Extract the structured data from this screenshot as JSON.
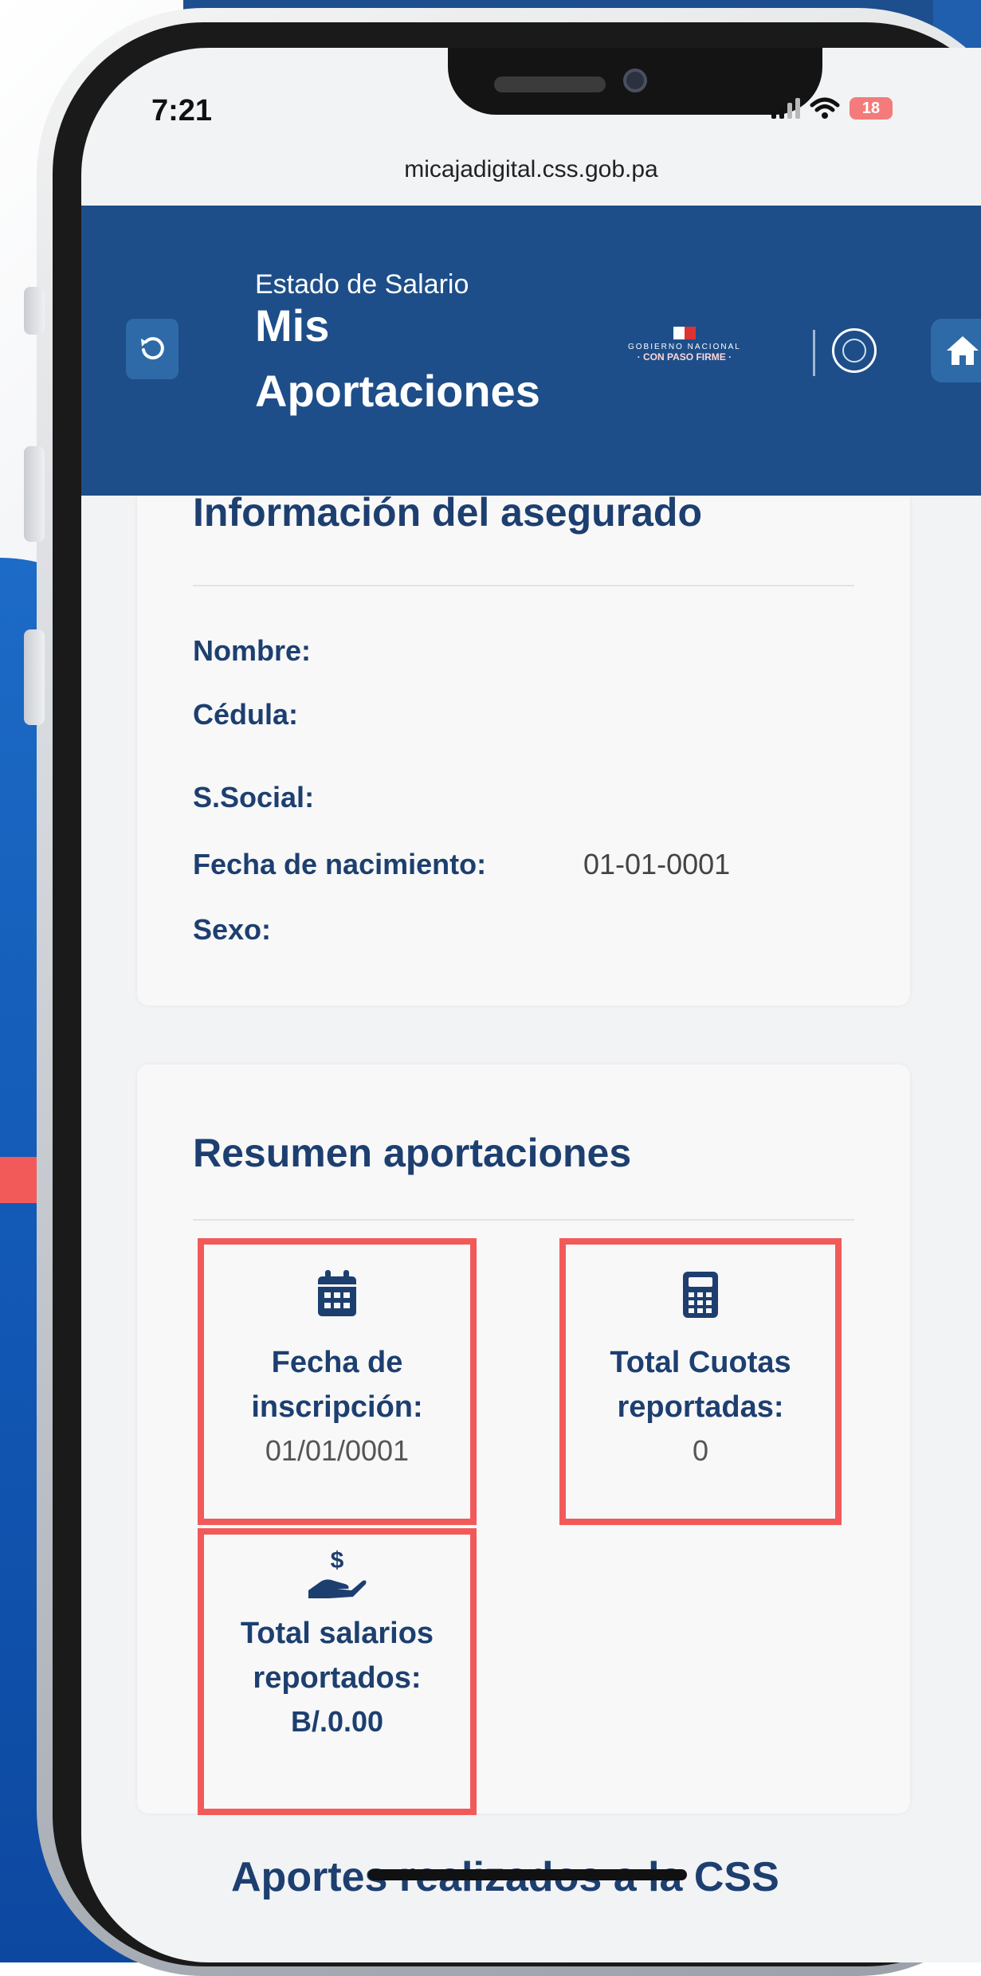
{
  "status_bar": {
    "time": "7:21",
    "battery": "18"
  },
  "browser": {
    "url": "micajadigital.css.gob.pa"
  },
  "header": {
    "subtitle": "Estado de Salario",
    "title_line1": "Mis",
    "title_line2": "Aportaciones",
    "gov_logo_line1": "GOBIERNO NACIONAL",
    "gov_logo_line2": "· CON PASO FIRME ·"
  },
  "insured_info": {
    "title": "Información del asegurado",
    "fields": [
      {
        "label": "Nombre:",
        "value": ""
      },
      {
        "label": "Cédula:",
        "value": ""
      },
      {
        "label": "S.Social:",
        "value": ""
      },
      {
        "label": "Fecha de nacimiento:",
        "value": "01-01-0001"
      },
      {
        "label": "Sexo:",
        "value": ""
      }
    ]
  },
  "summary": {
    "title": "Resumen aportaciones",
    "enrollment": {
      "label_line1": "Fecha de",
      "label_line2": "inscripción:",
      "value": "01/01/0001",
      "icon": "calendar-icon"
    },
    "quotas": {
      "label_line1": "Total Cuotas",
      "label_line2": "reportadas:",
      "value": "0",
      "icon": "calculator-icon"
    },
    "salaries": {
      "label_line1": "Total salarios",
      "label_line2": "reportados:",
      "value": "B/.0.00",
      "icon": "hand-money-icon"
    }
  },
  "next_section": {
    "title": "Aportes realizados a la CSS"
  },
  "colors": {
    "header": "#1d4e89",
    "accent": "#f25a5a",
    "text": "#1d3f70"
  }
}
